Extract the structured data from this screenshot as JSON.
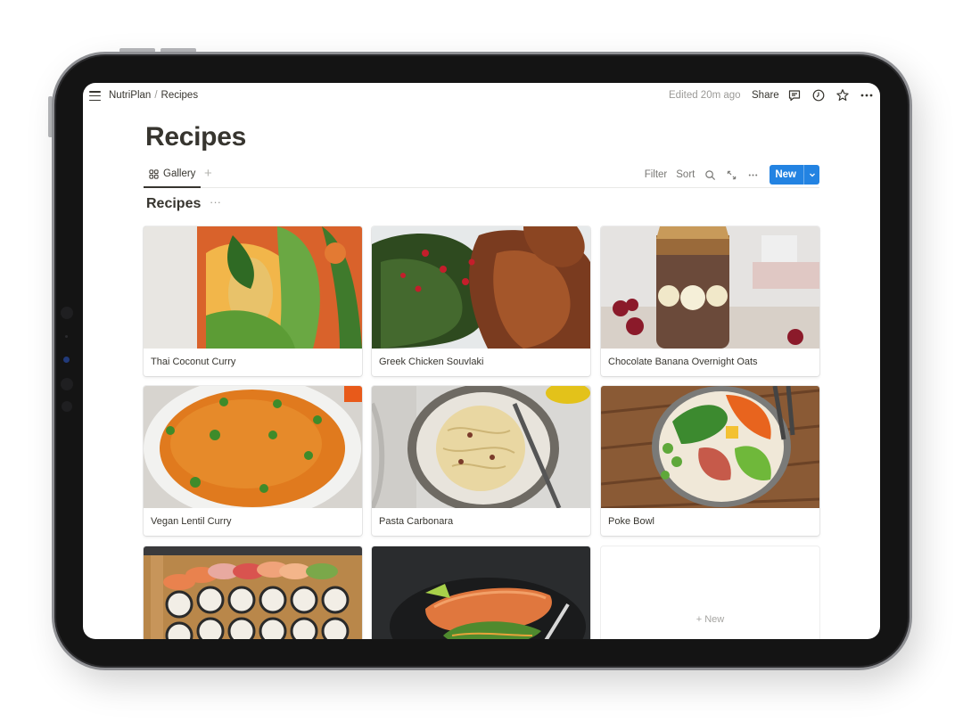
{
  "topbar": {
    "workspace": "NutriPlan",
    "separator": "/",
    "page": "Recipes",
    "edited": "Edited 20m ago",
    "share_label": "Share",
    "icons": [
      "comment-icon",
      "history-icon",
      "star-icon",
      "more-icon"
    ]
  },
  "page": {
    "title": "Recipes"
  },
  "viewbar": {
    "tab_label": "Gallery",
    "add_view": "+",
    "filter_label": "Filter",
    "sort_label": "Sort",
    "more_label": "···",
    "new_label": "New"
  },
  "database": {
    "title": "Recipes",
    "more_label": "···"
  },
  "gallery": {
    "cards": [
      {
        "name": "Thai Coconut Curry",
        "theme": "thai"
      },
      {
        "name": "Greek Chicken Souvlaki",
        "theme": "greek"
      },
      {
        "name": "Chocolate Banana Overnight Oats",
        "theme": "oats"
      },
      {
        "name": "Vegan Lentil Curry",
        "theme": "lentil"
      },
      {
        "name": "Pasta Carbonara",
        "theme": "pasta"
      },
      {
        "name": "Poke Bowl",
        "theme": "poke"
      },
      {
        "name": "",
        "theme": "sushi"
      },
      {
        "name": "",
        "theme": "salmon"
      }
    ],
    "new_card_label": "+ New"
  },
  "colors": {
    "accent": "#2383e2",
    "text": "#37352f",
    "muted": "#9b9a97"
  }
}
